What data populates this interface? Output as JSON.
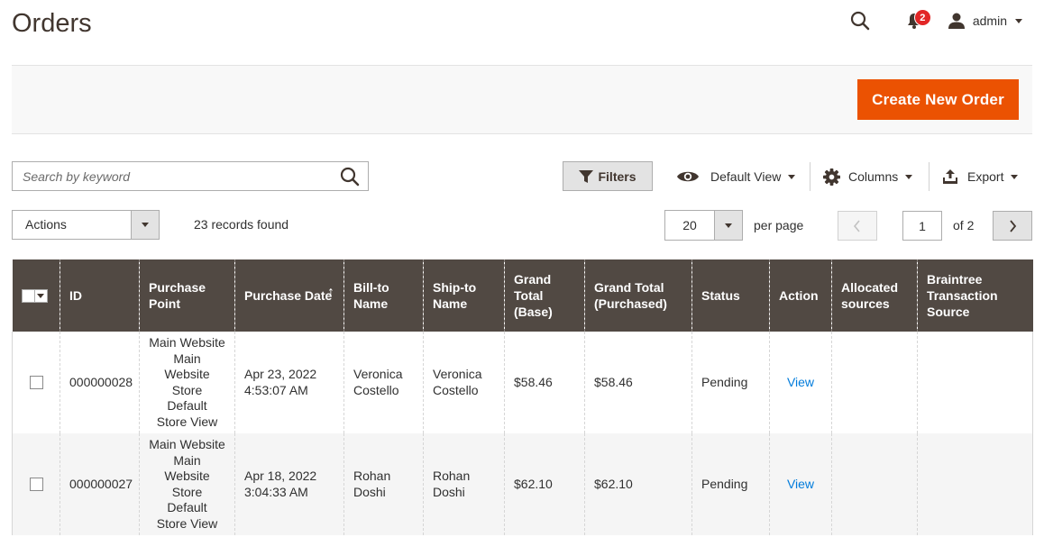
{
  "page": {
    "title": "Orders"
  },
  "header": {
    "notifications_count": "2",
    "user_name": "admin"
  },
  "page_actions": {
    "create_label": "Create New Order"
  },
  "toolbar": {
    "search_placeholder": "Search by keyword",
    "filters_label": "Filters",
    "view_label": "Default View",
    "columns_label": "Columns",
    "export_label": "Export",
    "actions_label": "Actions",
    "records_found": "23 records found",
    "per_page_value": "20",
    "per_page_label": "per page",
    "current_page": "1",
    "total_pages_label": "of 2"
  },
  "grid": {
    "columns": [
      "ID",
      "Purchase Point",
      "Purchase Date",
      "Bill-to Name",
      "Ship-to Name",
      "Grand Total (Base)",
      "Grand Total (Purchased)",
      "Status",
      "Action",
      "Allocated sources",
      "Braintree Transaction Source"
    ],
    "sort_indicator": "↑",
    "rows": [
      {
        "id": "000000028",
        "purchase_point": [
          "Main Website",
          "Main",
          "Website Store",
          "Default",
          "Store View"
        ],
        "purchase_date": [
          "Apr 23, 2022",
          "4:53:07 AM"
        ],
        "bill_to": [
          "Veronica",
          "Costello"
        ],
        "ship_to": [
          "Veronica",
          "Costello"
        ],
        "grand_total_base": "$58.46",
        "grand_total_purchased": "$58.46",
        "status": "Pending",
        "action": "View",
        "allocated_sources": "",
        "braintree_source": ""
      },
      {
        "id": "000000027",
        "purchase_point": [
          "Main Website",
          "Main",
          "Website Store",
          "Default",
          "Store View"
        ],
        "purchase_date": [
          "Apr 18, 2022",
          "3:04:33 AM"
        ],
        "bill_to": [
          "Rohan",
          "Doshi"
        ],
        "ship_to": [
          "Rohan",
          "Doshi"
        ],
        "grand_total_base": "$62.10",
        "grand_total_purchased": "$62.10",
        "status": "Pending",
        "action": "View",
        "allocated_sources": "",
        "braintree_source": ""
      }
    ]
  },
  "icons": {
    "search": "search-icon",
    "notifications": "bell-icon",
    "user": "user-icon",
    "filter": "funnel-icon",
    "view": "eye-icon",
    "columns": "gear-icon",
    "export": "export-icon",
    "prev": "chevron-left-icon",
    "next": "chevron-right-icon"
  },
  "colors": {
    "accent": "#eb5202",
    "header_bg": "#514943",
    "link": "#007bdb",
    "badge": "#e22626"
  }
}
